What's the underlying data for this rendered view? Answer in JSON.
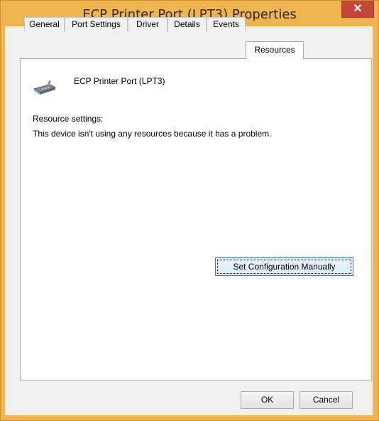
{
  "window": {
    "title": "ECP Printer Port (LPT3) Properties",
    "close_label": "✕"
  },
  "tabs": [
    {
      "label": "General"
    },
    {
      "label": "Port Settings"
    },
    {
      "label": "Driver"
    },
    {
      "label": "Details"
    },
    {
      "label": "Events"
    },
    {
      "label": "Resources",
      "active": true
    }
  ],
  "resources": {
    "device_name": "ECP Printer Port (LPT3)",
    "settings_label": "Resource settings:",
    "message": "This device isn't using any resources because it has a problem.",
    "set_config_label": "Set Configuration Manually"
  },
  "footer": {
    "ok_label": "OK",
    "cancel_label": "Cancel"
  },
  "colors": {
    "frame": "#f0b44f",
    "close": "#c7463b",
    "focus_border": "#3c7fb1"
  }
}
